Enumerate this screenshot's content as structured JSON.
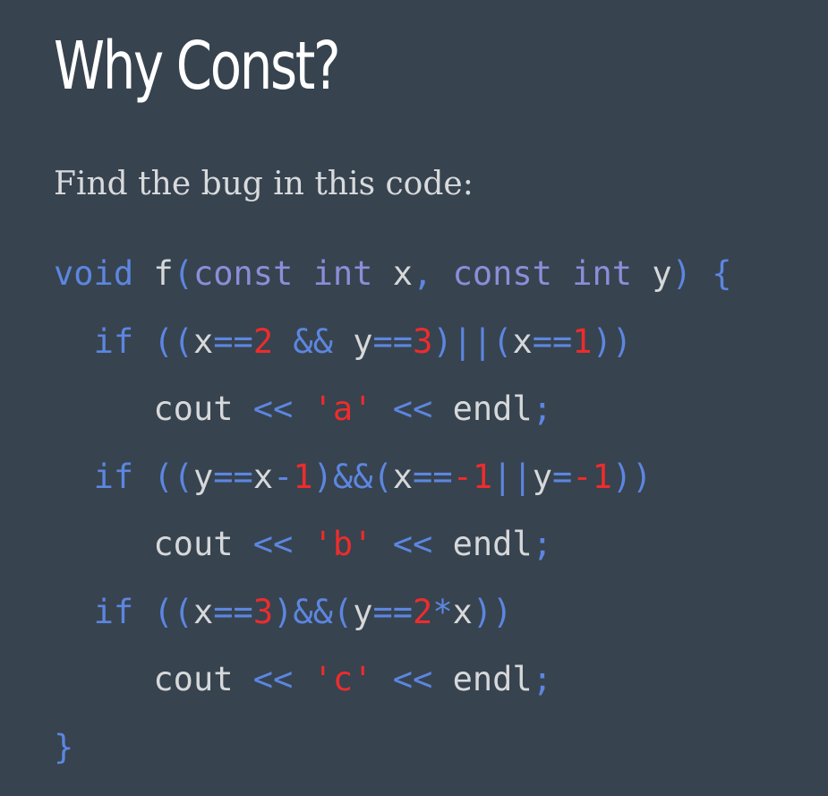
{
  "slide": {
    "title": "Why Const?",
    "subtitle": "Find the bug in this code:"
  },
  "colors": {
    "background": "#37434f",
    "title": "#ffffff",
    "subtitle": "#d8dadc",
    "keyword": "#5c86e0",
    "type": "#8b8ed8",
    "operator": "#5c86e0",
    "number": "#ee2c2c",
    "string": "#ee2c2c",
    "identifier": "#d6d8da"
  },
  "code": {
    "lines": [
      {
        "tokens": [
          {
            "t": "kw",
            "v": "void"
          },
          {
            "t": "ws",
            "v": " "
          },
          {
            "t": "id",
            "v": "f"
          },
          {
            "t": "op",
            "v": "("
          },
          {
            "t": "type",
            "v": "const"
          },
          {
            "t": "ws",
            "v": " "
          },
          {
            "t": "type",
            "v": "int"
          },
          {
            "t": "ws",
            "v": " "
          },
          {
            "t": "id",
            "v": "x"
          },
          {
            "t": "op",
            "v": ","
          },
          {
            "t": "ws",
            "v": " "
          },
          {
            "t": "type",
            "v": "const"
          },
          {
            "t": "ws",
            "v": " "
          },
          {
            "t": "type",
            "v": "int"
          },
          {
            "t": "ws",
            "v": " "
          },
          {
            "t": "id",
            "v": "y"
          },
          {
            "t": "op",
            "v": ")"
          },
          {
            "t": "ws",
            "v": " "
          },
          {
            "t": "op",
            "v": "{"
          }
        ]
      },
      {
        "tokens": [
          {
            "t": "ws",
            "v": "  "
          },
          {
            "t": "kw",
            "v": "if"
          },
          {
            "t": "ws",
            "v": " "
          },
          {
            "t": "op",
            "v": "(("
          },
          {
            "t": "id",
            "v": "x"
          },
          {
            "t": "op",
            "v": "=="
          },
          {
            "t": "num",
            "v": "2"
          },
          {
            "t": "ws",
            "v": " "
          },
          {
            "t": "op",
            "v": "&&"
          },
          {
            "t": "ws",
            "v": " "
          },
          {
            "t": "id",
            "v": "y"
          },
          {
            "t": "op",
            "v": "=="
          },
          {
            "t": "num",
            "v": "3"
          },
          {
            "t": "op",
            "v": ")||("
          },
          {
            "t": "id",
            "v": "x"
          },
          {
            "t": "op",
            "v": "=="
          },
          {
            "t": "num",
            "v": "1"
          },
          {
            "t": "op",
            "v": "))"
          }
        ]
      },
      {
        "tokens": [
          {
            "t": "ws",
            "v": "     "
          },
          {
            "t": "id",
            "v": "cout"
          },
          {
            "t": "ws",
            "v": " "
          },
          {
            "t": "op",
            "v": "<<"
          },
          {
            "t": "ws",
            "v": " "
          },
          {
            "t": "str",
            "v": "'a'"
          },
          {
            "t": "ws",
            "v": " "
          },
          {
            "t": "op",
            "v": "<<"
          },
          {
            "t": "ws",
            "v": " "
          },
          {
            "t": "id",
            "v": "endl"
          },
          {
            "t": "op",
            "v": ";"
          }
        ]
      },
      {
        "tokens": [
          {
            "t": "ws",
            "v": "  "
          },
          {
            "t": "kw",
            "v": "if"
          },
          {
            "t": "ws",
            "v": " "
          },
          {
            "t": "op",
            "v": "(("
          },
          {
            "t": "id",
            "v": "y"
          },
          {
            "t": "op",
            "v": "=="
          },
          {
            "t": "id",
            "v": "x"
          },
          {
            "t": "op",
            "v": "-"
          },
          {
            "t": "num",
            "v": "1"
          },
          {
            "t": "op",
            "v": ")&&("
          },
          {
            "t": "id",
            "v": "x"
          },
          {
            "t": "op",
            "v": "=="
          },
          {
            "t": "num",
            "v": "-1"
          },
          {
            "t": "op",
            "v": "||"
          },
          {
            "t": "id",
            "v": "y"
          },
          {
            "t": "op",
            "v": "="
          },
          {
            "t": "num",
            "v": "-1"
          },
          {
            "t": "op",
            "v": "))"
          }
        ]
      },
      {
        "tokens": [
          {
            "t": "ws",
            "v": "     "
          },
          {
            "t": "id",
            "v": "cout"
          },
          {
            "t": "ws",
            "v": " "
          },
          {
            "t": "op",
            "v": "<<"
          },
          {
            "t": "ws",
            "v": " "
          },
          {
            "t": "str",
            "v": "'b'"
          },
          {
            "t": "ws",
            "v": " "
          },
          {
            "t": "op",
            "v": "<<"
          },
          {
            "t": "ws",
            "v": " "
          },
          {
            "t": "id",
            "v": "endl"
          },
          {
            "t": "op",
            "v": ";"
          }
        ]
      },
      {
        "tokens": [
          {
            "t": "ws",
            "v": "  "
          },
          {
            "t": "kw",
            "v": "if"
          },
          {
            "t": "ws",
            "v": " "
          },
          {
            "t": "op",
            "v": "(("
          },
          {
            "t": "id",
            "v": "x"
          },
          {
            "t": "op",
            "v": "=="
          },
          {
            "t": "num",
            "v": "3"
          },
          {
            "t": "op",
            "v": ")&&("
          },
          {
            "t": "id",
            "v": "y"
          },
          {
            "t": "op",
            "v": "=="
          },
          {
            "t": "num",
            "v": "2"
          },
          {
            "t": "op",
            "v": "*"
          },
          {
            "t": "id",
            "v": "x"
          },
          {
            "t": "op",
            "v": "))"
          }
        ]
      },
      {
        "tokens": [
          {
            "t": "ws",
            "v": "     "
          },
          {
            "t": "id",
            "v": "cout"
          },
          {
            "t": "ws",
            "v": " "
          },
          {
            "t": "op",
            "v": "<<"
          },
          {
            "t": "ws",
            "v": " "
          },
          {
            "t": "str",
            "v": "'c'"
          },
          {
            "t": "ws",
            "v": " "
          },
          {
            "t": "op",
            "v": "<<"
          },
          {
            "t": "ws",
            "v": " "
          },
          {
            "t": "id",
            "v": "endl"
          },
          {
            "t": "op",
            "v": ";"
          }
        ]
      },
      {
        "tokens": [
          {
            "t": "op",
            "v": "}"
          }
        ]
      }
    ]
  }
}
